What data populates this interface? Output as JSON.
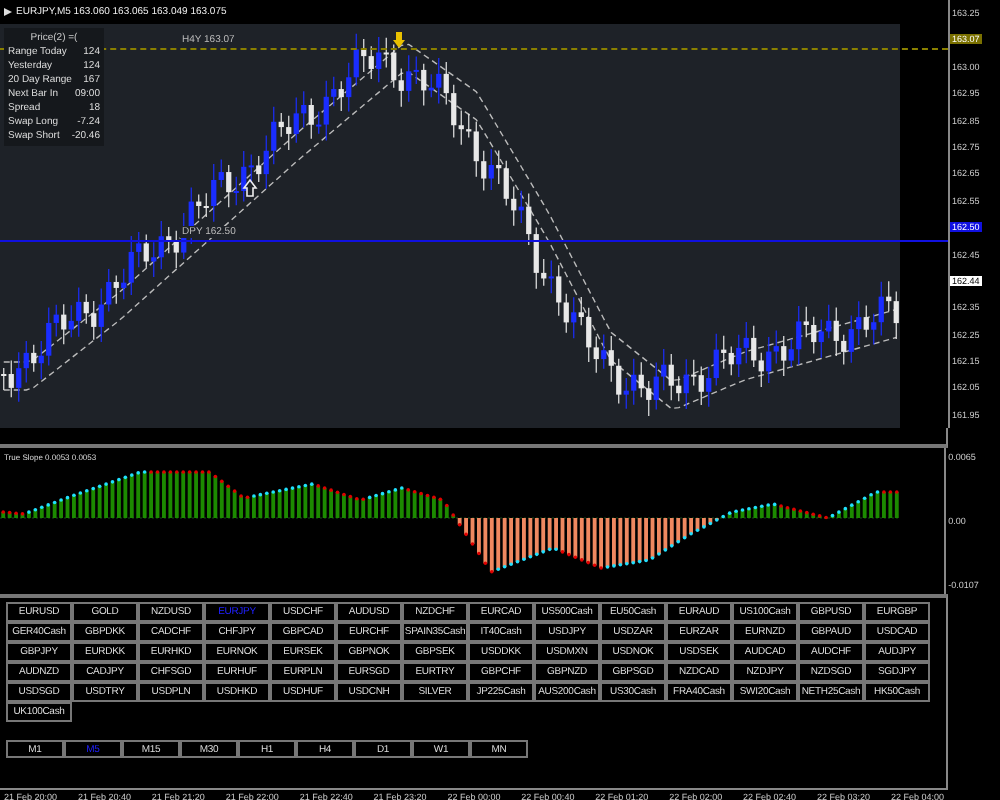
{
  "header": {
    "text": "EURJPY,M5  163.060 163.065 163.049 163.075"
  },
  "info_panel": {
    "title": "Price(2) =(",
    "rows": [
      {
        "label": "Range Today",
        "value": "124"
      },
      {
        "label": "Yesterday",
        "value": "124"
      },
      {
        "label": "20 Day Range",
        "value": "167"
      },
      {
        "label": "Next Bar In",
        "value": "09:00"
      },
      {
        "label": "Spread",
        "value": "18"
      },
      {
        "label": "Swap Long",
        "value": "-7.24"
      },
      {
        "label": "Swap Short",
        "value": "-20.46"
      }
    ]
  },
  "chart": {
    "levels": [
      {
        "label": "H4Y 163.07",
        "kind": "resistance"
      },
      {
        "label": "DPY 162.50",
        "kind": "pivot"
      }
    ]
  },
  "price_axis": [
    {
      "label": "163.25",
      "kind": "plain"
    },
    {
      "label": "163.07",
      "kind": "resistance"
    },
    {
      "label": "163.00",
      "kind": "plain"
    },
    {
      "label": "162.95",
      "kind": "plain"
    },
    {
      "label": "162.85",
      "kind": "plain"
    },
    {
      "label": "162.75",
      "kind": "plain"
    },
    {
      "label": "162.65",
      "kind": "plain"
    },
    {
      "label": "162.55",
      "kind": "plain"
    },
    {
      "label": "162.50",
      "kind": "pivot"
    },
    {
      "label": "162.45",
      "kind": "plain"
    },
    {
      "label": "162.44",
      "kind": "current"
    },
    {
      "label": "162.35",
      "kind": "plain"
    },
    {
      "label": "162.25",
      "kind": "plain"
    },
    {
      "label": "162.15",
      "kind": "plain"
    },
    {
      "label": "162.05",
      "kind": "plain"
    },
    {
      "label": "161.95",
      "kind": "plain"
    }
  ],
  "indicator": {
    "title": "True Slope 0.0053 0.0053",
    "axis": [
      "0.0065",
      "0.00",
      "-0.0107"
    ]
  },
  "symbols": [
    {
      "label": "EURUSD",
      "selected": false
    },
    {
      "label": "GOLD",
      "selected": false
    },
    {
      "label": "NZDUSD",
      "selected": false
    },
    {
      "label": "EURJPY",
      "selected": true
    },
    {
      "label": "USDCHF",
      "selected": false
    },
    {
      "label": "AUDUSD",
      "selected": false
    },
    {
      "label": "NZDCHF",
      "selected": false
    },
    {
      "label": "EURCAD",
      "selected": false
    },
    {
      "label": "US500Cash",
      "selected": false
    },
    {
      "label": "EU50Cash",
      "selected": false
    },
    {
      "label": "EURAUD",
      "selected": false
    },
    {
      "label": "US100Cash",
      "selected": false
    },
    {
      "label": "GBPUSD",
      "selected": false
    },
    {
      "label": "EURGBP",
      "selected": false
    },
    {
      "label": "GER40Cash",
      "selected": false
    },
    {
      "label": "GBPDKK",
      "selected": false
    },
    {
      "label": "CADCHF",
      "selected": false
    },
    {
      "label": "CHFJPY",
      "selected": false
    },
    {
      "label": "GBPCAD",
      "selected": false
    },
    {
      "label": "EURCHF",
      "selected": false
    },
    {
      "label": "SPAIN35Cash",
      "selected": false
    },
    {
      "label": "IT40Cash",
      "selected": false
    },
    {
      "label": "USDJPY",
      "selected": false
    },
    {
      "label": "USDZAR",
      "selected": false
    },
    {
      "label": "EURZAR",
      "selected": false
    },
    {
      "label": "EURNZD",
      "selected": false
    },
    {
      "label": "GBPAUD",
      "selected": false
    },
    {
      "label": "USDCAD",
      "selected": false
    },
    {
      "label": "GBPJPY",
      "selected": false
    },
    {
      "label": "EURDKK",
      "selected": false
    },
    {
      "label": "EURHKD",
      "selected": false
    },
    {
      "label": "EURNOK",
      "selected": false
    },
    {
      "label": "EURSEK",
      "selected": false
    },
    {
      "label": "GBPNOK",
      "selected": false
    },
    {
      "label": "GBPSEK",
      "selected": false
    },
    {
      "label": "USDDKK",
      "selected": false
    },
    {
      "label": "USDMXN",
      "selected": false
    },
    {
      "label": "USDNOK",
      "selected": false
    },
    {
      "label": "USDSEK",
      "selected": false
    },
    {
      "label": "AUDCAD",
      "selected": false
    },
    {
      "label": "AUDCHF",
      "selected": false
    },
    {
      "label": "AUDJPY",
      "selected": false
    },
    {
      "label": "AUDNZD",
      "selected": false
    },
    {
      "label": "CADJPY",
      "selected": false
    },
    {
      "label": "CHFSGD",
      "selected": false
    },
    {
      "label": "EURHUF",
      "selected": false
    },
    {
      "label": "EURPLN",
      "selected": false
    },
    {
      "label": "EURSGD",
      "selected": false
    },
    {
      "label": "EURTRY",
      "selected": false
    },
    {
      "label": "GBPCHF",
      "selected": false
    },
    {
      "label": "GBPNZD",
      "selected": false
    },
    {
      "label": "GBPSGD",
      "selected": false
    },
    {
      "label": "NZDCAD",
      "selected": false
    },
    {
      "label": "NZDJPY",
      "selected": false
    },
    {
      "label": "NZDSGD",
      "selected": false
    },
    {
      "label": "SGDJPY",
      "selected": false
    },
    {
      "label": "USDSGD",
      "selected": false
    },
    {
      "label": "USDTRY",
      "selected": false
    },
    {
      "label": "USDPLN",
      "selected": false
    },
    {
      "label": "USDHKD",
      "selected": false
    },
    {
      "label": "USDHUF",
      "selected": false
    },
    {
      "label": "USDCNH",
      "selected": false
    },
    {
      "label": "SILVER",
      "selected": false
    },
    {
      "label": "JP225Cash",
      "selected": false
    },
    {
      "label": "AUS200Cash",
      "selected": false
    },
    {
      "label": "US30Cash",
      "selected": false
    },
    {
      "label": "FRA40Cash",
      "selected": false
    },
    {
      "label": "SWI20Cash",
      "selected": false
    },
    {
      "label": "NETH25Cash",
      "selected": false
    },
    {
      "label": "HK50Cash",
      "selected": false
    },
    {
      "label": "UK100Cash",
      "selected": false
    }
  ],
  "timeframes": [
    {
      "label": "M1",
      "selected": false
    },
    {
      "label": "M5",
      "selected": true
    },
    {
      "label": "M15",
      "selected": false
    },
    {
      "label": "M30",
      "selected": false
    },
    {
      "label": "H1",
      "selected": false
    },
    {
      "label": "H4",
      "selected": false
    },
    {
      "label": "D1",
      "selected": false
    },
    {
      "label": "W1",
      "selected": false
    },
    {
      "label": "MN",
      "selected": false
    }
  ],
  "time_axis": [
    "21 Feb 20:00",
    "21 Feb 20:40",
    "21 Feb 21:20",
    "21 Feb 22:00",
    "21 Feb 22:40",
    "21 Feb 23:20",
    "22 Feb 00:00",
    "22 Feb 00:40",
    "22 Feb 01:20",
    "22 Feb 02:00",
    "22 Feb 02:40",
    "22 Feb 03:20",
    "22 Feb 04:00"
  ]
}
